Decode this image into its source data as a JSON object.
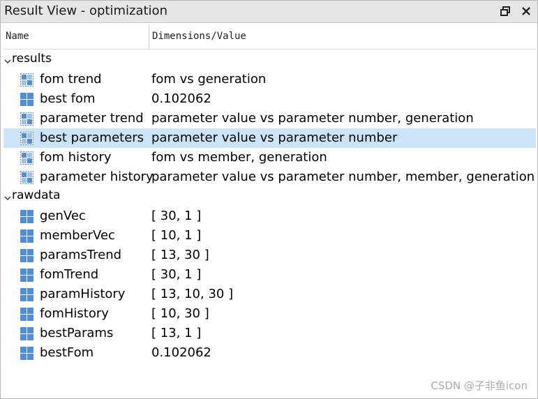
{
  "window": {
    "title": "Result View - optimization",
    "restore_icon": "restore-window-icon",
    "close_icon": "close-icon"
  },
  "columns": {
    "name": "Name",
    "dims": "Dimensions/Value"
  },
  "groups": [
    {
      "label": "results",
      "items": [
        {
          "name": "fom trend",
          "value": "fom vs generation",
          "icon": "dataset-sparse-icon"
        },
        {
          "name": "best fom",
          "value": "0.102062",
          "icon": "matrix-icon"
        },
        {
          "name": "parameter trend",
          "value": "parameter value vs parameter number, generation",
          "icon": "dataset-sparse-icon"
        },
        {
          "name": "best parameters",
          "value": "parameter value vs parameter number",
          "icon": "dataset-sparse-icon",
          "selected": true
        },
        {
          "name": "fom history",
          "value": "fom vs member, generation",
          "icon": "dataset-sparse-icon"
        },
        {
          "name": "parameter history",
          "value": "parameter value vs parameter number, member, generation",
          "icon": "dataset-sparse-icon"
        }
      ]
    },
    {
      "label": "rawdata",
      "items": [
        {
          "name": "genVec",
          "value": "[ 30, 1 ]",
          "icon": "matrix-icon"
        },
        {
          "name": "memberVec",
          "value": "[ 10, 1 ]",
          "icon": "matrix-icon"
        },
        {
          "name": "paramsTrend",
          "value": "[ 13, 30 ]",
          "icon": "matrix-icon"
        },
        {
          "name": "fomTrend",
          "value": "[ 30, 1 ]",
          "icon": "matrix-icon"
        },
        {
          "name": "paramHistory",
          "value": "[ 13, 10, 30 ]",
          "icon": "matrix-icon"
        },
        {
          "name": "fomHistory",
          "value": "[ 10, 30 ]",
          "icon": "matrix-icon"
        },
        {
          "name": "bestParams",
          "value": "[ 13, 1 ]",
          "icon": "matrix-icon"
        },
        {
          "name": "bestFom",
          "value": "0.102062",
          "icon": "matrix-icon"
        }
      ]
    }
  ],
  "watermark": "CSDN @子非鱼icon",
  "colors": {
    "icon_blue": "#4a8fe0",
    "selection": "#cce4f7",
    "titlebar": "#e6e6e6"
  }
}
